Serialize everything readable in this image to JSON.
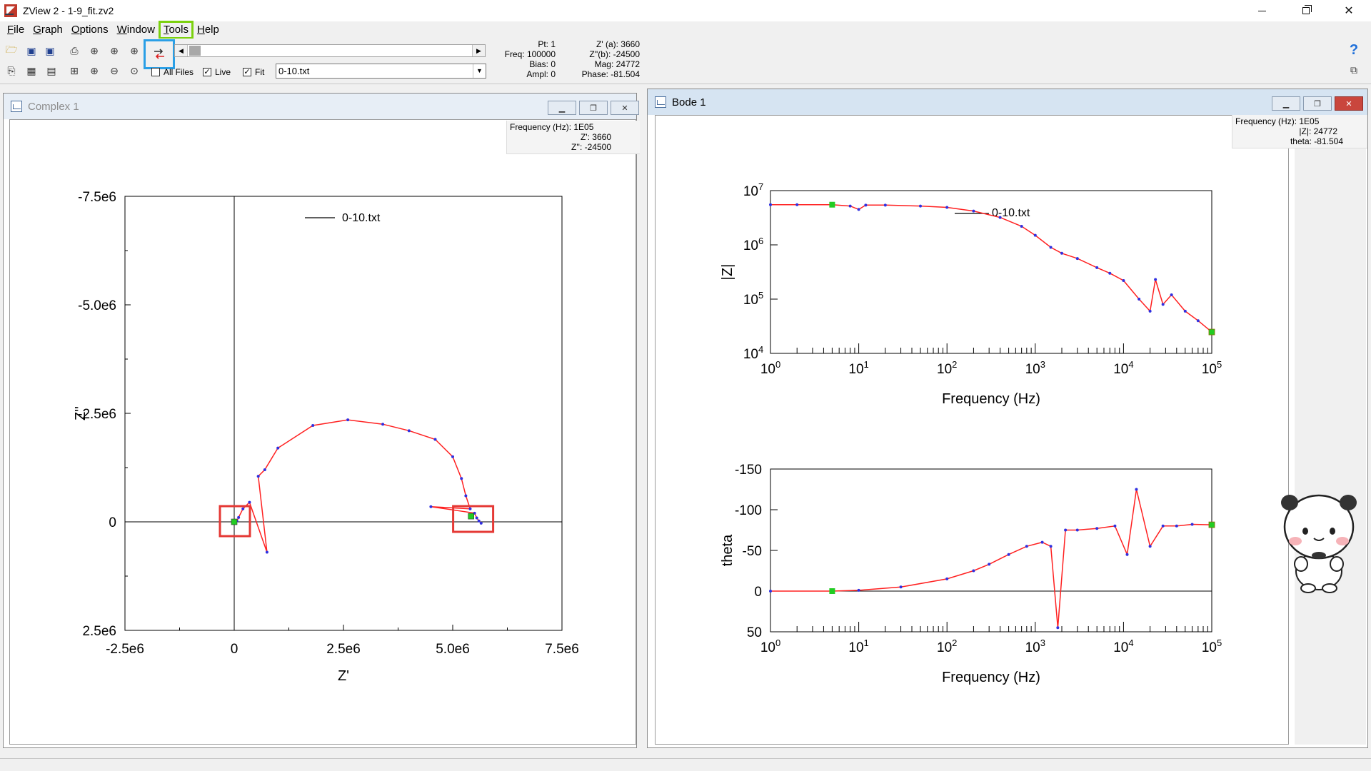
{
  "app": {
    "title": "ZView 2 - 1-9_fit.zv2"
  },
  "menu": [
    {
      "label": "File",
      "u": "F",
      "rest": "ile"
    },
    {
      "label": "Graph",
      "u": "G",
      "rest": "raph"
    },
    {
      "label": "Options",
      "u": "O",
      "rest": "ptions"
    },
    {
      "label": "Window",
      "u": "W",
      "rest": "indow"
    },
    {
      "label": "Tools",
      "u": "T",
      "rest": "ools",
      "highlighted": true
    },
    {
      "label": "Help",
      "u": "H",
      "rest": "elp"
    }
  ],
  "toolbar": {
    "all_files_label": "All Files",
    "all_files_checked": false,
    "live_label": "Live",
    "live_checked": true,
    "fit_label": "Fit",
    "fit_checked": true,
    "file_select_value": "0-10.txt",
    "highlighted_tool_icon": "swap-arrows-icon"
  },
  "point_info": {
    "pt": "Pt: 1",
    "freq": "Freq: 100000",
    "bias": "Bias: 0",
    "ampl": "Ampl: 0",
    "zreal": "Z' (a): 3660",
    "zimag": "Z''(b): -24500",
    "mag": "Mag: 24772",
    "phase": "Phase: -81.504"
  },
  "complex_window": {
    "title": "Complex 1",
    "readout": [
      "Frequency (Hz): 1E05",
      "Z': 3660",
      "Z'': -24500"
    ],
    "legend": "0-10.txt",
    "xlabel": "Z'",
    "ylabel": "Z''"
  },
  "bode_window": {
    "title": "Bode 1",
    "readout": [
      "Frequency (Hz): 1E05",
      "|Z|: 24772",
      "theta: -81.504"
    ],
    "legend": "0-10.txt",
    "xlabel": "Frequency (Hz)",
    "ylabel_top": "|Z|",
    "ylabel_bottom": "theta"
  },
  "colors": {
    "fit_line": "#ff2020",
    "data_points": "#3030e0",
    "marker": "#22cc22",
    "menu_highlight": "#7bd10e",
    "tool_highlight": "#2a9fe6",
    "roi_box": "#e53935"
  },
  "chart_data": [
    {
      "type": "scatter",
      "title": "",
      "xlabel": "Z'",
      "ylabel": "Z''",
      "xlim": [
        -2500000,
        7500000
      ],
      "ylim": [
        2500000,
        -7500000
      ],
      "xticks": [
        "-2.5e6",
        "0",
        "2.5e6",
        "5.0e6",
        "7.5e6"
      ],
      "yticks": [
        "-7.5e6",
        "-5.0e6",
        "-2.5e6",
        "0",
        "2.5e6"
      ],
      "legend": "0-10.txt",
      "legend_position": "top-left",
      "series": [
        {
          "name": "0-10.txt",
          "points": [
            [
              5650000,
              30000
            ],
            [
              5600000,
              -20000
            ],
            [
              5550000,
              -90000
            ],
            [
              5500000,
              -200000
            ],
            [
              4500000,
              -350000
            ],
            [
              5400000,
              -300000
            ],
            [
              5300000,
              -600000
            ],
            [
              5200000,
              -1000000
            ],
            [
              5000000,
              -1500000
            ],
            [
              4600000,
              -1900000
            ],
            [
              4000000,
              -2100000
            ],
            [
              3400000,
              -2250000
            ],
            [
              2600000,
              -2350000
            ],
            [
              1800000,
              -2220000
            ],
            [
              1000000,
              -1700000
            ],
            [
              700000,
              -1200000
            ],
            [
              550000,
              -1050000
            ],
            [
              750000,
              700000
            ],
            [
              350000,
              -450000
            ],
            [
              200000,
              -300000
            ],
            [
              100000,
              -100000
            ],
            [
              60000,
              -20000
            ],
            [
              20000,
              0
            ]
          ]
        }
      ]
    },
    {
      "type": "line",
      "title": "",
      "xlabel": "Frequency (Hz)",
      "ylabel": "|Z|",
      "xscale": "log",
      "yscale": "log",
      "xlim": [
        1,
        100000
      ],
      "ylim": [
        10000,
        10000000
      ],
      "xticks": [
        "10^0",
        "10^1",
        "10^2",
        "10^3",
        "10^4",
        "10^5"
      ],
      "yticks": [
        "10^4",
        "10^5",
        "10^6",
        "10^7"
      ],
      "legend": "0-10.txt",
      "legend_position": "top-center",
      "series": [
        {
          "name": "0-10.txt",
          "points": [
            [
              1,
              5500000
            ],
            [
              2,
              5500000
            ],
            [
              5,
              5500000
            ],
            [
              8,
              5200000
            ],
            [
              10,
              4500000
            ],
            [
              12,
              5400000
            ],
            [
              20,
              5400000
            ],
            [
              50,
              5200000
            ],
            [
              100,
              4900000
            ],
            [
              200,
              4200000
            ],
            [
              400,
              3200000
            ],
            [
              700,
              2200000
            ],
            [
              1000,
              1500000
            ],
            [
              1500,
              900000
            ],
            [
              2000,
              700000
            ],
            [
              3000,
              560000
            ],
            [
              5000,
              380000
            ],
            [
              7000,
              300000
            ],
            [
              10000,
              220000
            ],
            [
              15000,
              100000
            ],
            [
              20000,
              60000
            ],
            [
              23000,
              230000
            ],
            [
              28000,
              80000
            ],
            [
              35000,
              120000
            ],
            [
              50000,
              60000
            ],
            [
              70000,
              40000
            ],
            [
              100000,
              24772
            ]
          ]
        }
      ]
    },
    {
      "type": "line",
      "title": "",
      "xlabel": "Frequency (Hz)",
      "ylabel": "theta",
      "xscale": "log",
      "xlim": [
        1,
        100000
      ],
      "ylim": [
        50,
        -150
      ],
      "xticks": [
        "10^0",
        "10^1",
        "10^2",
        "10^3",
        "10^4",
        "10^5"
      ],
      "yticks": [
        "-150",
        "-100",
        "-50",
        "0",
        "50"
      ],
      "series": [
        {
          "name": "0-10.txt",
          "points": [
            [
              1,
              0
            ],
            [
              5,
              0
            ],
            [
              10,
              -1
            ],
            [
              30,
              -5
            ],
            [
              100,
              -15
            ],
            [
              200,
              -25
            ],
            [
              300,
              -33
            ],
            [
              500,
              -45
            ],
            [
              800,
              -55
            ],
            [
              1200,
              -60
            ],
            [
              1500,
              -55
            ],
            [
              1800,
              45
            ],
            [
              2200,
              -75
            ],
            [
              3000,
              -75
            ],
            [
              5000,
              -77
            ],
            [
              8000,
              -80
            ],
            [
              11000,
              -45
            ],
            [
              14000,
              -125
            ],
            [
              20000,
              -55
            ],
            [
              28000,
              -80
            ],
            [
              40000,
              -80
            ],
            [
              60000,
              -82
            ],
            [
              100000,
              -81.5
            ]
          ]
        }
      ]
    }
  ]
}
